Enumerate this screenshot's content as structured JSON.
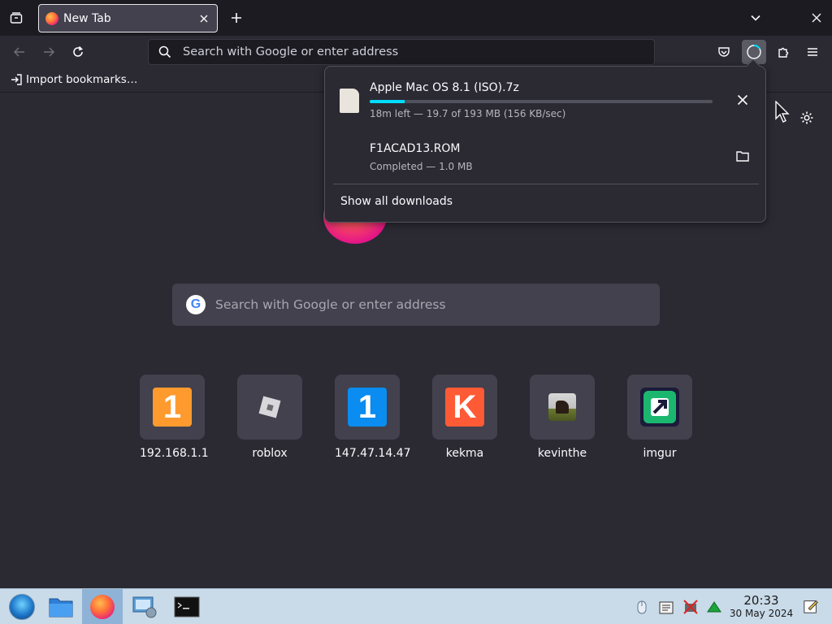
{
  "tabs": [
    {
      "title": "New Tab"
    }
  ],
  "toolbar": {
    "url_placeholder": "Search with Google or enter address"
  },
  "bookmarks": {
    "import_label": "Import bookmarks…"
  },
  "newtab": {
    "search_placeholder": "Search with Google or enter address",
    "top_sites": [
      {
        "label": "192.168.1.1",
        "icon": "one-orange-icon",
        "color": "#ff9a2e"
      },
      {
        "label": "roblox",
        "icon": "roblox-icon",
        "color": "#42414d"
      },
      {
        "label": "147.47.14.47",
        "icon": "one-blue-icon",
        "color": "#0a8cf0"
      },
      {
        "label": "kekma",
        "icon": "k-letter-icon",
        "color": "#ff5a36"
      },
      {
        "label": "kevinthe",
        "icon": "horse-photo-icon",
        "color": "#6b6b3a"
      },
      {
        "label": "imgur",
        "icon": "imgur-arrow-icon",
        "color": "#1bb76e"
      }
    ]
  },
  "downloads": {
    "items": [
      {
        "name": "Apple Mac OS 8.1 (ISO).7z",
        "status": "18m left — 19.7 of 193 MB (156 KB/sec)",
        "progress": 0.102
      },
      {
        "name": "F1ACAD13.ROM",
        "status": "Completed — 1.0 MB"
      }
    ],
    "show_all_label": "Show all downloads"
  },
  "taskbar": {
    "time": "20:33",
    "date": "30 May 2024"
  },
  "colors": {
    "accent": "#00ddff",
    "background": "#2b2a33",
    "taskbar": "#c9dae8"
  }
}
